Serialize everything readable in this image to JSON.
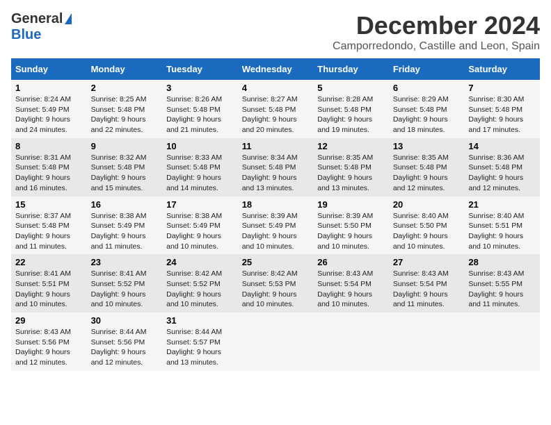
{
  "header": {
    "logo_general": "General",
    "logo_blue": "Blue",
    "title": "December 2024",
    "subtitle": "Camporredondo, Castille and Leon, Spain"
  },
  "days_of_week": [
    "Sunday",
    "Monday",
    "Tuesday",
    "Wednesday",
    "Thursday",
    "Friday",
    "Saturday"
  ],
  "weeks": [
    [
      {
        "day": "1",
        "sunrise": "8:24 AM",
        "sunset": "5:49 PM",
        "daylight": "9 hours and 24 minutes."
      },
      {
        "day": "2",
        "sunrise": "8:25 AM",
        "sunset": "5:48 PM",
        "daylight": "9 hours and 22 minutes."
      },
      {
        "day": "3",
        "sunrise": "8:26 AM",
        "sunset": "5:48 PM",
        "daylight": "9 hours and 21 minutes."
      },
      {
        "day": "4",
        "sunrise": "8:27 AM",
        "sunset": "5:48 PM",
        "daylight": "9 hours and 20 minutes."
      },
      {
        "day": "5",
        "sunrise": "8:28 AM",
        "sunset": "5:48 PM",
        "daylight": "9 hours and 19 minutes."
      },
      {
        "day": "6",
        "sunrise": "8:29 AM",
        "sunset": "5:48 PM",
        "daylight": "9 hours and 18 minutes."
      },
      {
        "day": "7",
        "sunrise": "8:30 AM",
        "sunset": "5:48 PM",
        "daylight": "9 hours and 17 minutes."
      }
    ],
    [
      {
        "day": "8",
        "sunrise": "8:31 AM",
        "sunset": "5:48 PM",
        "daylight": "9 hours and 16 minutes."
      },
      {
        "day": "9",
        "sunrise": "8:32 AM",
        "sunset": "5:48 PM",
        "daylight": "9 hours and 15 minutes."
      },
      {
        "day": "10",
        "sunrise": "8:33 AM",
        "sunset": "5:48 PM",
        "daylight": "9 hours and 14 minutes."
      },
      {
        "day": "11",
        "sunrise": "8:34 AM",
        "sunset": "5:48 PM",
        "daylight": "9 hours and 13 minutes."
      },
      {
        "day": "12",
        "sunrise": "8:35 AM",
        "sunset": "5:48 PM",
        "daylight": "9 hours and 13 minutes."
      },
      {
        "day": "13",
        "sunrise": "8:35 AM",
        "sunset": "5:48 PM",
        "daylight": "9 hours and 12 minutes."
      },
      {
        "day": "14",
        "sunrise": "8:36 AM",
        "sunset": "5:48 PM",
        "daylight": "9 hours and 12 minutes."
      }
    ],
    [
      {
        "day": "15",
        "sunrise": "8:37 AM",
        "sunset": "5:48 PM",
        "daylight": "9 hours and 11 minutes."
      },
      {
        "day": "16",
        "sunrise": "8:38 AM",
        "sunset": "5:49 PM",
        "daylight": "9 hours and 11 minutes."
      },
      {
        "day": "17",
        "sunrise": "8:38 AM",
        "sunset": "5:49 PM",
        "daylight": "9 hours and 10 minutes."
      },
      {
        "day": "18",
        "sunrise": "8:39 AM",
        "sunset": "5:49 PM",
        "daylight": "9 hours and 10 minutes."
      },
      {
        "day": "19",
        "sunrise": "8:39 AM",
        "sunset": "5:50 PM",
        "daylight": "9 hours and 10 minutes."
      },
      {
        "day": "20",
        "sunrise": "8:40 AM",
        "sunset": "5:50 PM",
        "daylight": "9 hours and 10 minutes."
      },
      {
        "day": "21",
        "sunrise": "8:40 AM",
        "sunset": "5:51 PM",
        "daylight": "9 hours and 10 minutes."
      }
    ],
    [
      {
        "day": "22",
        "sunrise": "8:41 AM",
        "sunset": "5:51 PM",
        "daylight": "9 hours and 10 minutes."
      },
      {
        "day": "23",
        "sunrise": "8:41 AM",
        "sunset": "5:52 PM",
        "daylight": "9 hours and 10 minutes."
      },
      {
        "day": "24",
        "sunrise": "8:42 AM",
        "sunset": "5:52 PM",
        "daylight": "9 hours and 10 minutes."
      },
      {
        "day": "25",
        "sunrise": "8:42 AM",
        "sunset": "5:53 PM",
        "daylight": "9 hours and 10 minutes."
      },
      {
        "day": "26",
        "sunrise": "8:43 AM",
        "sunset": "5:54 PM",
        "daylight": "9 hours and 10 minutes."
      },
      {
        "day": "27",
        "sunrise": "8:43 AM",
        "sunset": "5:54 PM",
        "daylight": "9 hours and 11 minutes."
      },
      {
        "day": "28",
        "sunrise": "8:43 AM",
        "sunset": "5:55 PM",
        "daylight": "9 hours and 11 minutes."
      }
    ],
    [
      {
        "day": "29",
        "sunrise": "8:43 AM",
        "sunset": "5:56 PM",
        "daylight": "9 hours and 12 minutes."
      },
      {
        "day": "30",
        "sunrise": "8:44 AM",
        "sunset": "5:56 PM",
        "daylight": "9 hours and 12 minutes."
      },
      {
        "day": "31",
        "sunrise": "8:44 AM",
        "sunset": "5:57 PM",
        "daylight": "9 hours and 13 minutes."
      },
      null,
      null,
      null,
      null
    ]
  ],
  "labels": {
    "sunrise": "Sunrise:",
    "sunset": "Sunset:",
    "daylight": "Daylight:"
  }
}
